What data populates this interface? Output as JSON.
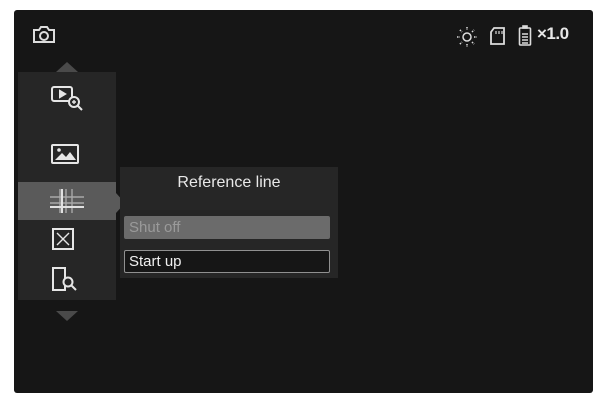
{
  "status_bar": {
    "zoom_label": "×1.0",
    "icons": [
      "camera-icon",
      "brightness-icon",
      "sd-card-icon",
      "battery-icon"
    ]
  },
  "sidebar": {
    "items": [
      {
        "icon": "playback-zoom-icon",
        "selected": false
      },
      {
        "icon": "image-icon",
        "selected": false
      },
      {
        "icon": "reference-line-icon",
        "selected": true
      },
      {
        "icon": "crosshair-box-icon",
        "selected": false
      },
      {
        "icon": "file-search-icon",
        "selected": false
      }
    ]
  },
  "submenu": {
    "title": "Reference line",
    "options": [
      {
        "label": "Shut off",
        "highlighted": true
      },
      {
        "label": "Start up",
        "highlighted": false
      }
    ]
  },
  "colors": {
    "screen_bg": "#161616",
    "panel_bg": "#262626",
    "selected_bg": "#5a5a5a",
    "text": "#e8e8e8"
  }
}
